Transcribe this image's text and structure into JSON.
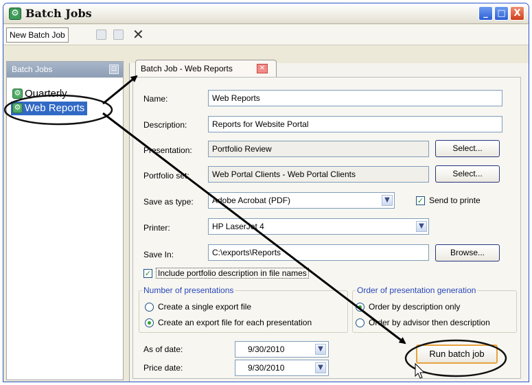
{
  "window": {
    "title": "Batch Jobs",
    "min_glyph": "_",
    "max_glyph": "□",
    "close_glyph": "X"
  },
  "toolbar": {
    "new_label": "New Batch Job",
    "delete_glyph": "✕"
  },
  "left_panel": {
    "header": "Batch Jobs",
    "pin_glyph": "⊡",
    "items": [
      {
        "label": "Quarterly",
        "icon": "gear-icon"
      },
      {
        "label": "Web Reports",
        "icon": "gear-icon",
        "selected": true
      }
    ]
  },
  "tab": {
    "label": "Batch Job - Web Reports",
    "close_glyph": "✕"
  },
  "form": {
    "name_label": "Name:",
    "name_value": "Web Reports",
    "description_label": "Description:",
    "description_value": "Reports for Website Portal",
    "presentation_label": "Presentation:",
    "presentation_value": "Portfolio Review",
    "portfolio_label": "Portfolio set:",
    "portfolio_value": "Web Portal Clients - Web Portal Clients",
    "select_label": "Select...",
    "save_type_label": "Save as type:",
    "save_type_value": "Adobe Acrobat (PDF)",
    "send_printer_label": "Send to printe",
    "printer_label": "Printer:",
    "printer_value": "HP LaserJet 4",
    "save_in_label": "Save In:",
    "save_in_value": "C:\\exports\\Reports",
    "browse_label": "Browse...",
    "include_desc_label": "Include portfolio description in file names",
    "num_group_title": "Number of presentations",
    "single_export_label": "Create a single export file",
    "each_export_label": "Create an export file for each presentation",
    "order_group_title": "Order of presentation generation",
    "order_desc_label": "Order by description only",
    "order_advisor_label": "Order by advisor then description",
    "as_of_label": "As of date:",
    "as_of_value": "9/30/2010",
    "price_date_label": "Price date:",
    "price_date_value": "9/30/2010",
    "run_label": "Run batch job"
  },
  "colors": {
    "accent": "#3169c6",
    "title_border": "#2a55c8",
    "group_title": "#2a47b8",
    "check_green": "#2ba534"
  },
  "dropdown_glyph": "▼",
  "check_glyph": "✓"
}
